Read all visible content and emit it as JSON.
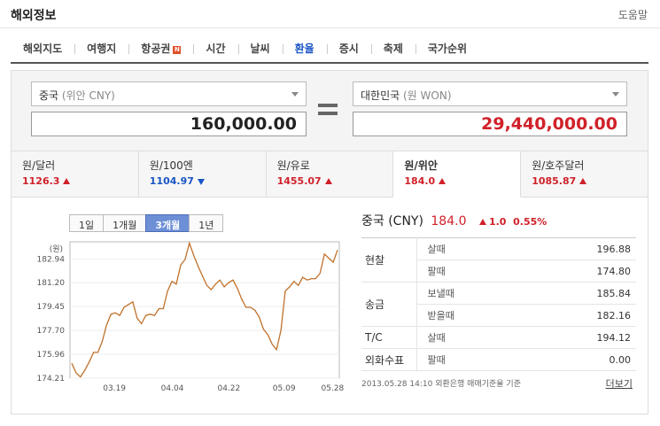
{
  "header": {
    "title": "해외정보",
    "help": "도움말"
  },
  "tabs": [
    {
      "label": "해외지도"
    },
    {
      "label": "여행지"
    },
    {
      "label": "항공권",
      "badge": "N"
    },
    {
      "label": "시간"
    },
    {
      "label": "날씨"
    },
    {
      "label": "환율",
      "active": true
    },
    {
      "label": "증시"
    },
    {
      "label": "축제"
    },
    {
      "label": "국가순위"
    }
  ],
  "converter": {
    "from_currency": "중국",
    "from_sub": "(위안 CNY)",
    "from_amount": "160,000.00",
    "to_currency": "대한민국",
    "to_sub": "(원 WON)",
    "to_amount": "29,440,000.00"
  },
  "rates": [
    {
      "name": "원/달러",
      "value": "1126.3",
      "dir": "up"
    },
    {
      "name": "원/100엔",
      "value": "1104.97",
      "dir": "down"
    },
    {
      "name": "원/유로",
      "value": "1455.07",
      "dir": "up"
    },
    {
      "name": "원/위안",
      "value": "184.0",
      "dir": "up",
      "active": true
    },
    {
      "name": "원/호주달러",
      "value": "1085.87",
      "dir": "up"
    }
  ],
  "periods": [
    {
      "label": "1일"
    },
    {
      "label": "1개월"
    },
    {
      "label": "3개월",
      "active": true
    },
    {
      "label": "1년"
    }
  ],
  "detail": {
    "title": "중국 (CNY)",
    "price": "184.0",
    "change": "1.0",
    "change_pct": "0.55%",
    "rows": [
      {
        "cat": "현찰",
        "label": "살때",
        "value": "196.88"
      },
      {
        "cat": "",
        "label": "팔때",
        "value": "174.80"
      },
      {
        "cat": "송금",
        "label": "보낼때",
        "value": "185.84"
      },
      {
        "cat": "",
        "label": "받을때",
        "value": "182.16"
      },
      {
        "cat": "T/C",
        "label": "살때",
        "value": "194.12"
      },
      {
        "cat": "외화수표",
        "label": "팔때",
        "value": "0.00"
      }
    ],
    "footnote": "2013.05.28 14:10 외환은행 매매기준율 기준",
    "more": "더보기"
  },
  "chart_data": {
    "type": "line",
    "ylabel": "(원)",
    "yticks": [
      174.21,
      175.96,
      177.7,
      179.45,
      181.2,
      182.94
    ],
    "ylim": [
      174.21,
      184.2
    ],
    "xticks": [
      "03.19",
      "04.04",
      "04.22",
      "05.09",
      "05.28"
    ],
    "color": "#c0712b",
    "values": [
      175.3,
      174.6,
      174.3,
      174.8,
      175.4,
      176.1,
      176.1,
      176.9,
      178.1,
      178.9,
      179.0,
      178.8,
      179.4,
      179.6,
      179.8,
      178.6,
      178.2,
      178.8,
      178.9,
      178.8,
      179.3,
      179.3,
      180.6,
      181.3,
      181.1,
      182.5,
      182.9,
      184.1,
      183.2,
      182.4,
      181.7,
      181.0,
      180.7,
      181.1,
      181.4,
      180.9,
      181.2,
      181.4,
      180.8,
      180.0,
      179.4,
      179.4,
      179.2,
      178.7,
      177.8,
      177.4,
      176.7,
      176.3,
      177.7,
      180.6,
      180.9,
      181.3,
      181.0,
      181.6,
      181.4,
      181.5,
      181.5,
      181.9,
      183.3,
      183.0,
      182.7,
      183.6
    ]
  }
}
